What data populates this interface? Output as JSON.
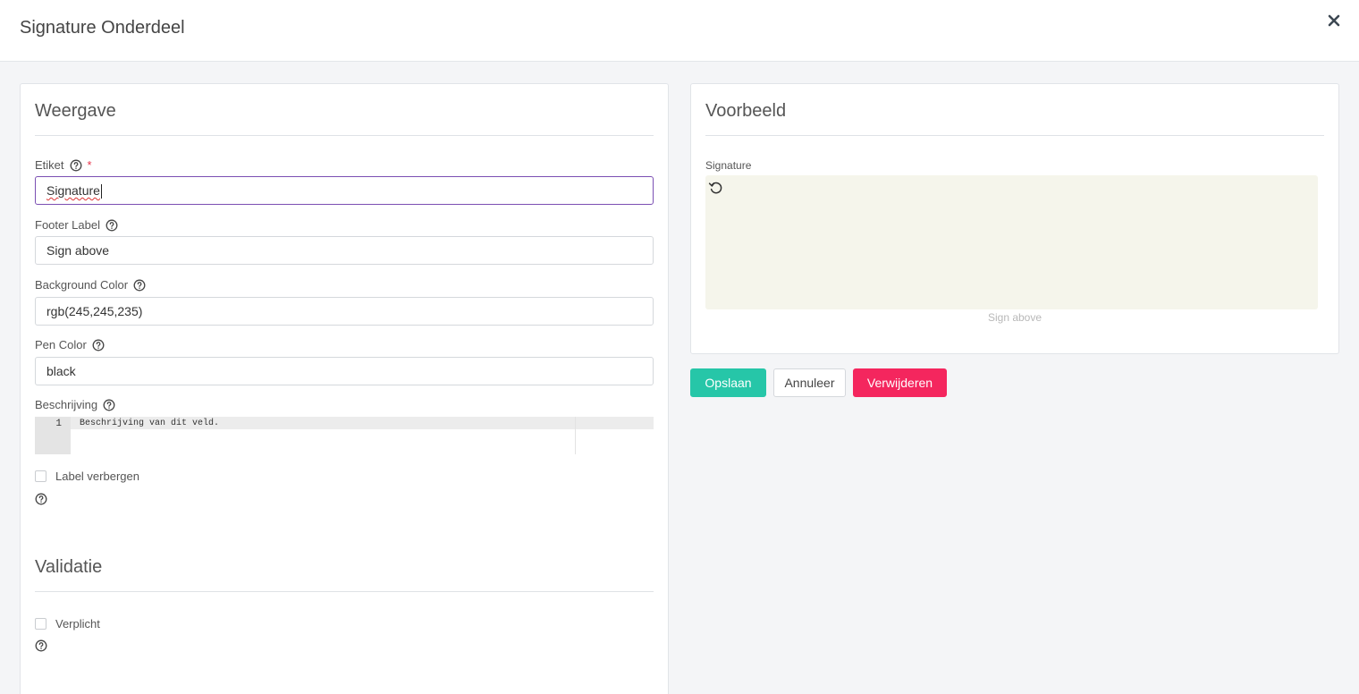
{
  "modal": {
    "title": "Signature Onderdeel"
  },
  "icons": {
    "close": "close-icon",
    "help": "help-circle-icon",
    "reset": "rotate-ccw-icon"
  },
  "display_section": {
    "title": "Weergave",
    "label_field": {
      "label": "Etiket",
      "required_mark": "*",
      "value": "Signature"
    },
    "footer_label_field": {
      "label": "Footer Label",
      "value": "Sign above"
    },
    "background_color_field": {
      "label": "Background Color",
      "value": "rgb(245,245,235)"
    },
    "pen_color_field": {
      "label": "Pen Color",
      "value": "black"
    },
    "description_field": {
      "label": "Beschrijving",
      "line_number": "1",
      "code": "Beschrijving van dit veld."
    },
    "hide_label_checkbox": {
      "label": "Label verbergen",
      "checked": false
    }
  },
  "validation_section": {
    "title": "Validatie",
    "required_checkbox": {
      "label": "Verplicht",
      "checked": false
    }
  },
  "preview_section": {
    "title": "Voorbeeld",
    "field_label": "Signature",
    "footer_text": "Sign above",
    "pad_background": "#f5f5eb"
  },
  "actions": {
    "save_label": "Opslaan",
    "cancel_label": "Annuleer",
    "delete_label": "Verwijderen"
  },
  "colors": {
    "accent_focus": "#7b4fb3",
    "save": "#26c6a8",
    "delete": "#f4265e",
    "required": "#e8334a"
  }
}
